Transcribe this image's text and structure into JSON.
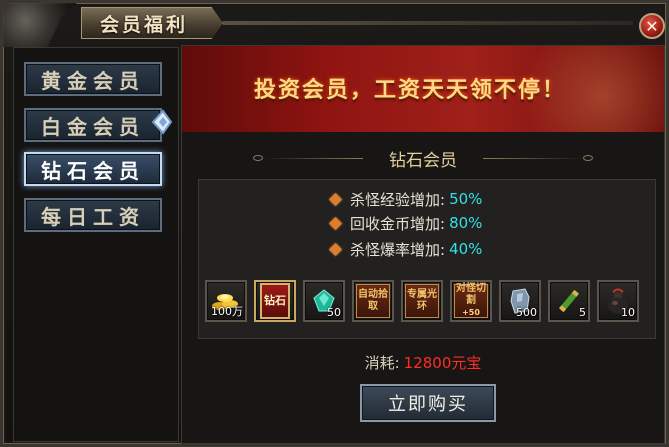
{
  "window": {
    "title": "会员福利",
    "close_icon": "close-icon"
  },
  "sidebar": {
    "items": [
      {
        "label": "黄金会员",
        "active": false
      },
      {
        "label": "白金会员",
        "active": false
      },
      {
        "label": "钻石会员",
        "active": true
      },
      {
        "label": "每日工资",
        "active": false
      }
    ]
  },
  "banner": {
    "text": "投资会员，工资天天领不停！"
  },
  "section": {
    "title": "钻石会员"
  },
  "benefits": [
    {
      "label": "杀怪经验增加:",
      "value": "50%"
    },
    {
      "label": "回收金币增加:",
      "value": "80%"
    },
    {
      "label": "杀怪爆率增加:",
      "value": "40%"
    }
  ],
  "rewards": [
    {
      "icon": "gold-ingots-icon",
      "qty": "100万"
    },
    {
      "icon": "diamond-card-icon",
      "text": "钻石"
    },
    {
      "icon": "green-gem-icon",
      "qty": "50"
    },
    {
      "icon": "auto-pickup-icon",
      "text": "自动拾取"
    },
    {
      "icon": "exclusive-aura-icon",
      "text": "专属光环"
    },
    {
      "icon": "monster-cut-icon",
      "text": "对怪切割",
      "sub": "+50"
    },
    {
      "icon": "stone-icon",
      "qty": "500"
    },
    {
      "icon": "scroll-icon",
      "qty": "5"
    },
    {
      "icon": "pouch-icon",
      "qty": "10"
    }
  ],
  "cost": {
    "label": "消耗:",
    "value": "12800元宝",
    "value_color": "#ff2d23"
  },
  "buy_button": {
    "label": "立即购买"
  },
  "colors": {
    "accent_value": "#31e0e8",
    "diamond_bullet": "#e07d2c"
  }
}
